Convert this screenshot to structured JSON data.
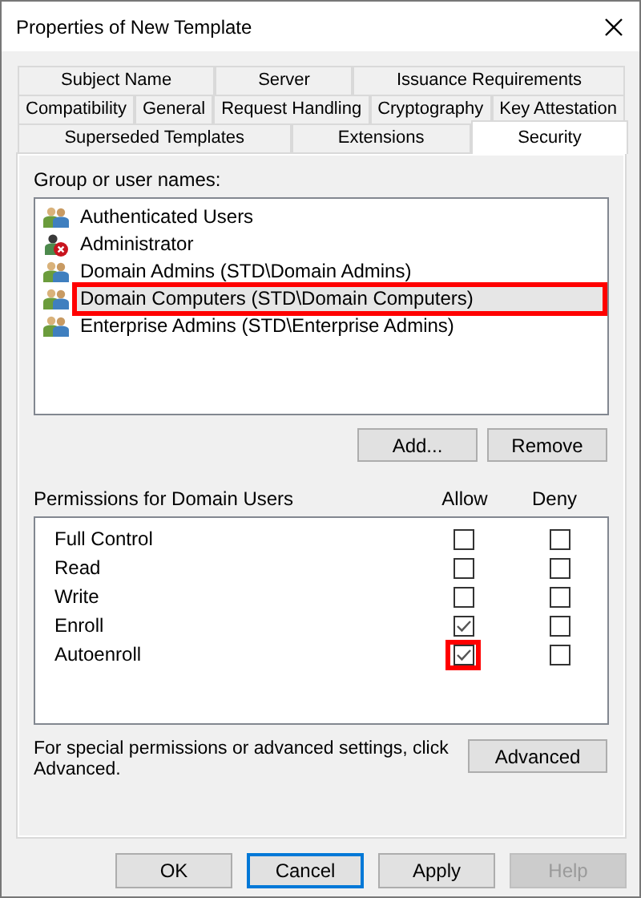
{
  "window": {
    "title": "Properties of New Template"
  },
  "tab_rows": [
    [
      {
        "label": "Subject Name",
        "selected": false
      },
      {
        "label": "Server",
        "selected": false
      },
      {
        "label": "Issuance Requirements",
        "selected": false
      }
    ],
    [
      {
        "label": "Compatibility",
        "selected": false
      },
      {
        "label": "General",
        "selected": false
      },
      {
        "label": "Request Handling",
        "selected": false
      },
      {
        "label": "Cryptography",
        "selected": false
      },
      {
        "label": "Key Attestation",
        "selected": false
      }
    ],
    [
      {
        "label": "Superseded Templates",
        "selected": false
      },
      {
        "label": "Extensions",
        "selected": false
      },
      {
        "label": "Security",
        "selected": true
      }
    ]
  ],
  "users_label": "Group or user names:",
  "users": [
    {
      "name": "Authenticated Users",
      "kind": "group",
      "selected": false,
      "highlighted": false
    },
    {
      "name": "Administrator",
      "kind": "disabled_user",
      "selected": false,
      "highlighted": false
    },
    {
      "name": "Domain Admins (STD\\Domain Admins)",
      "kind": "group",
      "selected": false,
      "highlighted": false
    },
    {
      "name": "Domain Computers (STD\\Domain Computers)",
      "kind": "group",
      "selected": true,
      "highlighted": true
    },
    {
      "name": "Enterprise Admins (STD\\Enterprise Admins)",
      "kind": "group",
      "selected": false,
      "highlighted": false
    }
  ],
  "user_buttons": [
    "Add...",
    "Remove"
  ],
  "permissions": {
    "title": "Permissions for Domain Users",
    "allow_header": "Allow",
    "deny_header": "Deny",
    "rows": [
      {
        "name": "Full Control",
        "allow": false,
        "deny": false,
        "allow_highlighted": false
      },
      {
        "name": "Read",
        "allow": false,
        "deny": false,
        "allow_highlighted": false
      },
      {
        "name": "Write",
        "allow": false,
        "deny": false,
        "allow_highlighted": false
      },
      {
        "name": "Enroll",
        "allow": true,
        "deny": false,
        "allow_highlighted": false
      },
      {
        "name": "Autoenroll",
        "allow": true,
        "deny": false,
        "allow_highlighted": true
      }
    ]
  },
  "advanced_note": "For special permissions or advanced settings, click Advanced.",
  "advanced_button": "Advanced",
  "footer_buttons": [
    {
      "label": "OK",
      "default": false,
      "disabled": false
    },
    {
      "label": "Cancel",
      "default": true,
      "disabled": false
    },
    {
      "label": "Apply",
      "default": false,
      "disabled": false
    },
    {
      "label": "Help",
      "default": false,
      "disabled": true
    }
  ]
}
